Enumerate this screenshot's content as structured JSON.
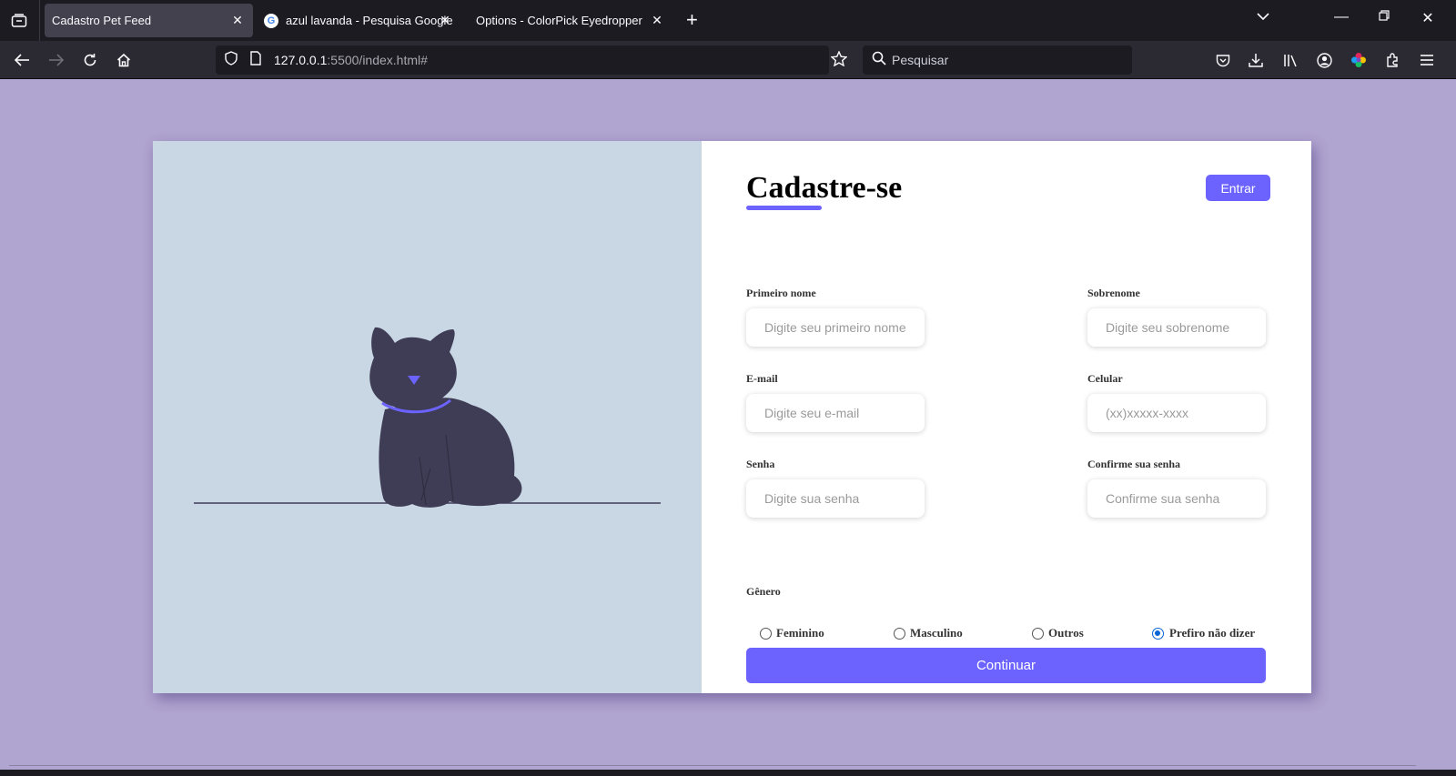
{
  "browser": {
    "tabs": [
      {
        "title": "Cadastro Pet Feed",
        "active": true
      },
      {
        "title": "azul lavanda - Pesquisa Google",
        "active": false
      },
      {
        "title": "Options - ColorPick Eyedropper",
        "active": false
      }
    ],
    "url": {
      "host": "127.0.0.1",
      "rest": ":5500/index.html#"
    },
    "search_placeholder": "Pesquisar"
  },
  "form": {
    "title": "Cadastre-se",
    "login_button": "Entrar",
    "fields": [
      {
        "label": "Primeiro nome",
        "placeholder": "Digite seu primeiro nome"
      },
      {
        "label": "Sobrenome",
        "placeholder": "Digite seu sobrenome"
      },
      {
        "label": "E-mail",
        "placeholder": "Digite seu e-mail"
      },
      {
        "label": "Celular",
        "placeholder": "(xx)xxxxx-xxxx"
      },
      {
        "label": "Senha",
        "placeholder": "Digite sua senha"
      },
      {
        "label": "Confirme sua senha",
        "placeholder": "Confirme sua senha"
      }
    ],
    "gender": {
      "label": "Gênero",
      "options": [
        "Feminino",
        "Masculino",
        "Outros",
        "Prefiro não dizer"
      ],
      "selected": "Prefiro não dizer"
    },
    "continue_button": "Continuar"
  },
  "colors": {
    "page_bg": "#b0a4d0",
    "illustration_bg": "#c9d7e5",
    "accent": "#6c63ff",
    "cat": "#3f3d56"
  }
}
